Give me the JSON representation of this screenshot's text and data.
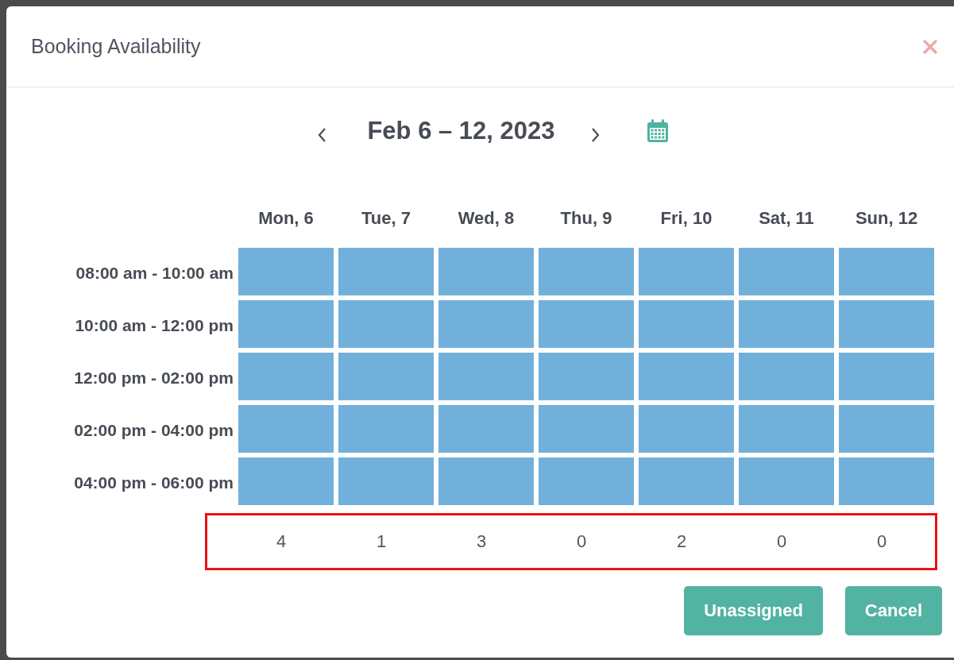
{
  "dialog": {
    "title": "Booking Availability"
  },
  "week_nav": {
    "range": "Feb 6 – 12, 2023"
  },
  "days": [
    "Mon, 6",
    "Tue, 7",
    "Wed, 8",
    "Thu, 9",
    "Fri, 10",
    "Sat, 11",
    "Sun, 12"
  ],
  "time_slots": [
    "08:00 am - 10:00 am",
    "10:00 am - 12:00 pm",
    "12:00 pm - 02:00 pm",
    "02:00 pm - 04:00 pm",
    "04:00 pm - 06:00 pm"
  ],
  "totals": [
    "4",
    "1",
    "3",
    "0",
    "2",
    "0",
    "0"
  ],
  "buttons": [
    "Unassigned",
    "Cancel"
  ]
}
